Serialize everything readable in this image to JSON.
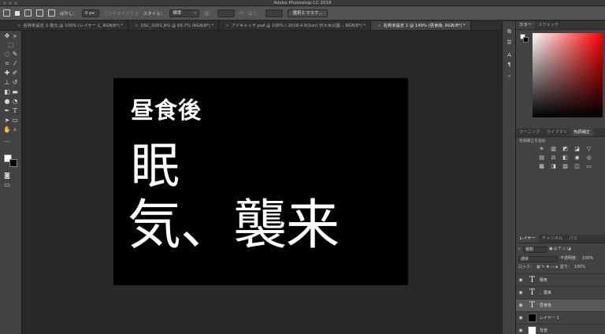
{
  "window": {
    "title": "Adobe Photoshop CC 2018"
  },
  "options_bar": {
    "feather_label": "ぼかし：",
    "feather_value": "0 px",
    "antialias_label": "アンチエイリアス",
    "style_label": "スタイル：",
    "style_value": "標準",
    "width_label": "幅：",
    "height_label": "高さ：",
    "mask_button": "選択とマスク..."
  },
  "tabs": [
    {
      "label": "名称未設定 1-復元 @ 100% (レイヤー 1, RGB/8*) *",
      "active": false
    },
    {
      "label": "DSC_0281.JPG @ 66.7% (RGB/8*) *",
      "active": false
    },
    {
      "label": "アイキャッチ.psd @ 100% ( 2018.4.8(Sun) 代々木公園 -, RGB/8*) *",
      "active": false
    },
    {
      "label": "名称未設定 1 @ 149% (昼食後, RGB/8*) *",
      "active": true
    }
  ],
  "document": {
    "line1": "昼食後",
    "line2": "眠",
    "line3": "気、襲来",
    "background": "#000000",
    "text_color": "#ffffff"
  },
  "color_panel": {
    "tabs": [
      "カラー",
      "スウォッチ"
    ],
    "hue_color": "#ff0000",
    "foreground": "#ffffff",
    "background": "#000000"
  },
  "adjust_panel": {
    "tabs": [
      "ラーニング",
      "ライブラリ",
      "色調補正"
    ],
    "add_label": "色調補正を追加"
  },
  "layers_panel": {
    "tabs": [
      "レイヤー",
      "チャンネル",
      "パス"
    ],
    "kind_label": "種類",
    "blend_mode": "通常",
    "opacity_label": "不透明度：",
    "opacity_value": "100%",
    "lock_label": "ロック：",
    "fill_label": "塗り：",
    "fill_value": "100%",
    "layers": [
      {
        "name": "眠気",
        "type": "text",
        "selected": false
      },
      {
        "name": "、襲来",
        "type": "text",
        "selected": false
      },
      {
        "name": "昼食後",
        "type": "text",
        "selected": true
      },
      {
        "name": "レイヤー 1",
        "type": "black",
        "selected": false
      },
      {
        "name": "背景",
        "type": "white",
        "selected": false
      }
    ]
  }
}
